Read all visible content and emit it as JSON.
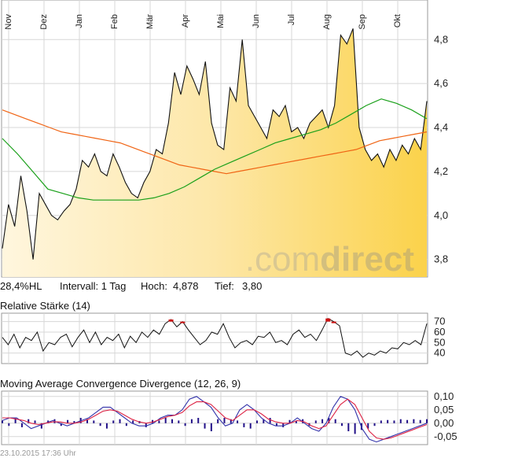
{
  "chart_data": [
    {
      "type": "area",
      "x_ticks": [
        "Nov",
        "Dez",
        "Jan",
        "Feb",
        "Mär",
        "Apr",
        "Mai",
        "Jun",
        "Jul",
        "Aug",
        "Sep",
        "Okt"
      ],
      "ylim": [
        3.72,
        4.98
      ],
      "y_ticks": [
        "3,8",
        "4,0",
        "4,2",
        "4,4",
        "4,6",
        "4,8"
      ],
      "y_tick_values": [
        3.8,
        4.0,
        4.2,
        4.4,
        4.6,
        4.8
      ],
      "grid": true,
      "series": [
        {
          "values": [
            3.85,
            4.05,
            3.95,
            4.18,
            4.02,
            3.8,
            4.1,
            4.05,
            4.0,
            3.98,
            4.02,
            4.05,
            4.12,
            4.25,
            4.22,
            4.28,
            4.2,
            4.18,
            4.28,
            4.22,
            4.15,
            4.1,
            4.08,
            4.15,
            4.2,
            4.3,
            4.28,
            4.42,
            4.65,
            4.55,
            4.68,
            4.62,
            4.55,
            4.7,
            4.42,
            4.32,
            4.3,
            4.58,
            4.52,
            4.8,
            4.5,
            4.45,
            4.4,
            4.35,
            4.48,
            4.45,
            4.5,
            4.38,
            4.4,
            4.35,
            4.42,
            4.45,
            4.48,
            4.4,
            4.5,
            4.82,
            4.78,
            4.85,
            4.4,
            4.3,
            4.25,
            4.28,
            4.22,
            4.3,
            4.25,
            4.32,
            4.28,
            4.35,
            4.3,
            4.52
          ],
          "color": "#111111"
        },
        {
          "values": [
            4.48,
            4.46,
            4.44,
            4.42,
            4.4,
            4.38,
            4.37,
            4.36,
            4.35,
            4.34,
            4.33,
            4.31,
            4.29,
            4.27,
            4.25,
            4.23,
            4.22,
            4.21,
            4.2,
            4.19,
            4.2,
            4.21,
            4.22,
            4.23,
            4.24,
            4.25,
            4.26,
            4.27,
            4.28,
            4.29,
            4.3,
            4.32,
            4.34,
            4.35,
            4.36,
            4.37,
            4.38
          ],
          "color": "#f06414"
        },
        {
          "values": [
            4.35,
            4.28,
            4.2,
            4.12,
            4.1,
            4.08,
            4.07,
            4.07,
            4.07,
            4.07,
            4.08,
            4.1,
            4.13,
            4.17,
            4.21,
            4.24,
            4.27,
            4.3,
            4.33,
            4.35,
            4.37,
            4.39,
            4.42,
            4.46,
            4.5,
            4.53,
            4.51,
            4.48,
            4.44
          ],
          "color": "#1aa01a"
        }
      ],
      "info": {
        "hl": "28,4%HL",
        "interval": "Intervall: 1 Tag",
        "high_label": "Hoch:",
        "high": "4,878",
        "low_label": "Tief:",
        "low": "3,80"
      },
      "watermark": {
        "part1": ".com",
        "part2": "direct"
      }
    },
    {
      "type": "line",
      "title": "Relative Stärke (14)",
      "ylim": [
        30,
        78
      ],
      "y_ticks": [
        "70",
        "60",
        "50",
        "40"
      ],
      "y_tick_values": [
        70,
        60,
        50,
        40
      ],
      "grid": true,
      "values": [
        55,
        48,
        58,
        45,
        55,
        52,
        60,
        42,
        50,
        48,
        55,
        58,
        46,
        55,
        62,
        50,
        60,
        48,
        55,
        52,
        58,
        45,
        56,
        50,
        60,
        55,
        62,
        58,
        68,
        72,
        65,
        70,
        62,
        55,
        48,
        52,
        60,
        58,
        68,
        55,
        45,
        50,
        52,
        48,
        56,
        55,
        60,
        50,
        52,
        48,
        58,
        62,
        55,
        58,
        52,
        62,
        73,
        70,
        66,
        40,
        38,
        42,
        36,
        40,
        38,
        42,
        40,
        45,
        44,
        50,
        48,
        52,
        48,
        68
      ],
      "overbought": 70,
      "color": "#111111"
    },
    {
      "type": "bar",
      "title": "Moving Average Convergence Divergence (12, 26, 9)",
      "ylim": [
        -0.08,
        0.12
      ],
      "y_ticks": [
        "0,10",
        "0,05",
        "0,00",
        "-0,05"
      ],
      "y_tick_values": [
        0.1,
        0.05,
        0.0,
        -0.05
      ],
      "grid": true,
      "histogram": [
        0.01,
        -0.01,
        0.02,
        -0.015,
        0.015,
        0.01,
        -0.02,
        0.01,
        0.015,
        -0.01,
        0.012,
        0.008,
        0.02,
        0.015,
        0.01,
        -0.01,
        -0.02,
        0.01,
        0.015,
        -0.01,
        0.01,
        0.008,
        -0.015,
        0.012,
        0.01,
        0.02,
        0.015,
        0.01,
        -0.01,
        0.015,
        0.02,
        -0.02,
        -0.03,
        0.015,
        0.02,
        0.015,
        0.01,
        -0.015,
        -0.02,
        0.01,
        0.015,
        0.02,
        -0.01,
        -0.015,
        0.012,
        0.01,
        0.015,
        -0.01,
        0.01,
        0.015,
        0.02,
        0.015,
        -0.01,
        -0.03,
        -0.04,
        -0.025,
        -0.02,
        -0.01,
        0.01,
        0.012,
        0.01,
        0.015,
        0.012,
        0.015,
        0.012,
        0.015
      ],
      "series": [
        {
          "values": [
            0.01,
            0.02,
            0.02,
            0.0,
            -0.02,
            -0.01,
            0.0,
            0.01,
            0.0,
            -0.01,
            0.0,
            0.01,
            0.02,
            0.04,
            0.06,
            0.06,
            0.04,
            0.02,
            0.0,
            -0.01,
            -0.01,
            0.0,
            0.02,
            0.03,
            0.03,
            0.05,
            0.09,
            0.1,
            0.08,
            0.06,
            0.02,
            -0.01,
            0.0,
            0.05,
            0.07,
            0.05,
            0.02,
            0.0,
            -0.01,
            -0.01,
            0.0,
            0.02,
            0.0,
            -0.02,
            -0.03,
            0.0,
            0.06,
            0.1,
            0.09,
            0.05,
            -0.02,
            -0.06,
            -0.07,
            -0.06,
            -0.05,
            -0.04,
            -0.03,
            -0.02,
            -0.01,
            0.0
          ],
          "color": "#3333aa"
        },
        {
          "values": [
            0.02,
            0.02,
            0.015,
            0.01,
            0.0,
            -0.005,
            0.0,
            0.005,
            0.005,
            0.0,
            0.0,
            0.005,
            0.015,
            0.03,
            0.045,
            0.05,
            0.045,
            0.03,
            0.015,
            0.005,
            0.0,
            0.005,
            0.015,
            0.025,
            0.03,
            0.04,
            0.065,
            0.08,
            0.08,
            0.07,
            0.045,
            0.02,
            0.01,
            0.03,
            0.05,
            0.05,
            0.035,
            0.015,
            0.005,
            0.0,
            0.0,
            0.01,
            0.005,
            -0.01,
            -0.02,
            -0.01,
            0.03,
            0.07,
            0.09,
            0.07,
            0.02,
            -0.03,
            -0.055,
            -0.06,
            -0.055,
            -0.045,
            -0.035,
            -0.025,
            -0.015,
            -0.005
          ],
          "color": "#dd2244"
        }
      ],
      "histogram_color": "#221188"
    }
  ],
  "footer": {
    "timestamp": "23.10.2015 17:36 Uhr"
  }
}
